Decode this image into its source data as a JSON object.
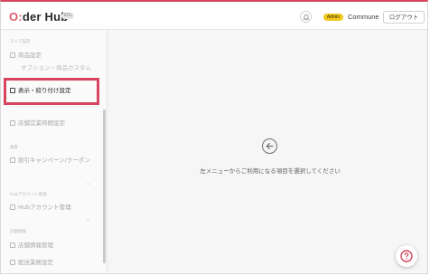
{
  "header": {
    "logo_prefix": "O:",
    "logo_middle": "der Hub",
    "env_badge": "STG",
    "admin_badge": "Admin",
    "company_name": "Commune",
    "logout_label": "ログアウト"
  },
  "sidebar": {
    "section_store": "ストア設定",
    "item_product_settings": "商品設定",
    "item_product_sub": "オプション・商品カスタム",
    "item_display_settings": "表示・絞り付け設定",
    "item_store_info": "店舗営業時間設定",
    "section_campaign": "集客",
    "item_campaign": "割引キャンペーン/クーポン",
    "section_account": "Hubアカウント管理",
    "item_account": "Hubアカウント管理",
    "section_store_info": "店舗情報",
    "item_store_management": "店舗情報管理",
    "item_delivery": "配送業務設定"
  },
  "main": {
    "instruction": "左メニューからご利用になる項目を選択してください"
  },
  "colors": {
    "brand_red": "#d7465e",
    "admin_yellow": "#f0c81e"
  },
  "icons": [
    "bell-icon",
    "arrow-left-icon",
    "help-icon",
    "chevron-down-icon"
  ]
}
